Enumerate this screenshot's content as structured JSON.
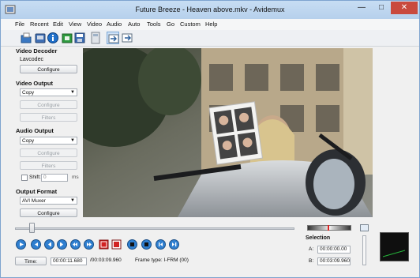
{
  "window": {
    "title": "Future Breeze - Heaven above.mkv - Avidemux",
    "minimize_glyph": "—",
    "maximize_glyph": "□",
    "close_glyph": "✕"
  },
  "menu": {
    "items": [
      "File",
      "Recent",
      "Edit",
      "View",
      "Video",
      "Audio",
      "Auto",
      "Tools",
      "Go",
      "Custom",
      "Help"
    ]
  },
  "toolbar": {
    "icons": [
      "open-file-icon",
      "open-folder-icon",
      "info-icon",
      "save-video-icon",
      "save-icon",
      "calculator-icon",
      "input-mode-icon",
      "output-mode-icon"
    ]
  },
  "video_decoder": {
    "title": "Video Decoder",
    "codec": "Lavcodec",
    "configure_label": "Configure"
  },
  "video_output": {
    "title": "Video Output",
    "selected": "Copy",
    "configure_label": "Configure",
    "filters_label": "Filters"
  },
  "audio_output": {
    "title": "Audio Output",
    "selected": "Copy",
    "configure_label": "Configure",
    "filters_label": "Filters",
    "shift_label": "Shift:",
    "shift_value": "0",
    "shift_unit": "ms"
  },
  "output_format": {
    "title": "Output Format",
    "selected": "AVI Muxer",
    "configure_label": "Configure"
  },
  "controls": {
    "icons": [
      "play-icon",
      "rewind-icon",
      "previous-frame-icon",
      "next-frame-icon",
      "previous-keyframe-icon",
      "next-keyframe-icon",
      "set-marker-a-icon",
      "set-marker-b-icon",
      "previous-black-frame-icon",
      "next-black-frame-icon",
      "go-first-frame-icon",
      "go-last-frame-icon"
    ]
  },
  "status": {
    "time_button": "Time:",
    "current_time": "00:00:11.680",
    "total_time": "/00:03:09.960",
    "frame_type": "Frame type: I-FRM (00)"
  },
  "selection": {
    "title": "Selection",
    "a_label": "A:",
    "a_value": "00:00:00.00",
    "b_label": "B:",
    "b_value": "00:03:09.960"
  },
  "playback": {
    "position_fraction": 0.062
  },
  "colors": {
    "accent": "#2f7fd0",
    "close_button": "#c94a3e",
    "marker_red": "#d22222"
  }
}
